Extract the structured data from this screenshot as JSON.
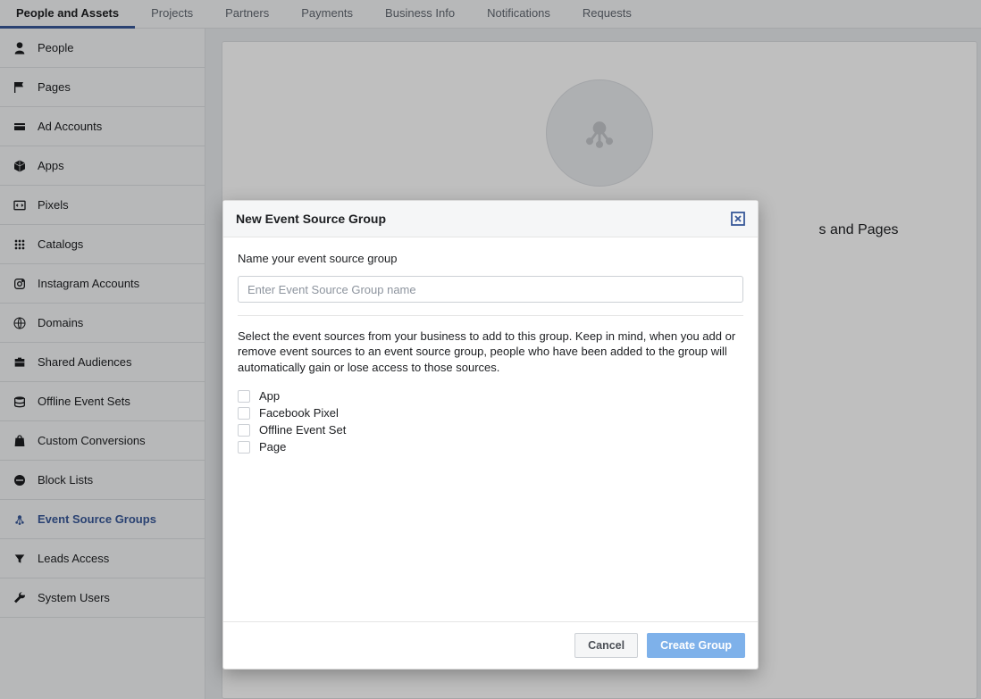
{
  "tabs": [
    {
      "label": "People and Assets",
      "active": true
    },
    {
      "label": "Projects",
      "active": false
    },
    {
      "label": "Partners",
      "active": false
    },
    {
      "label": "Payments",
      "active": false
    },
    {
      "label": "Business Info",
      "active": false
    },
    {
      "label": "Notifications",
      "active": false
    },
    {
      "label": "Requests",
      "active": false
    }
  ],
  "sidebar": [
    {
      "label": "People",
      "icon": "person-icon",
      "active": false
    },
    {
      "label": "Pages",
      "icon": "flag-icon",
      "active": false
    },
    {
      "label": "Ad Accounts",
      "icon": "card-icon",
      "active": false
    },
    {
      "label": "Apps",
      "icon": "cube-icon",
      "active": false
    },
    {
      "label": "Pixels",
      "icon": "code-icon",
      "active": false
    },
    {
      "label": "Catalogs",
      "icon": "grid-icon",
      "active": false
    },
    {
      "label": "Instagram Accounts",
      "icon": "instagram-icon",
      "active": false
    },
    {
      "label": "Domains",
      "icon": "globe-icon",
      "active": false
    },
    {
      "label": "Shared Audiences",
      "icon": "briefcase-icon",
      "active": false
    },
    {
      "label": "Offline Event Sets",
      "icon": "stack-icon",
      "active": false
    },
    {
      "label": "Custom Conversions",
      "icon": "bag-icon",
      "active": false
    },
    {
      "label": "Block Lists",
      "icon": "block-icon",
      "active": false
    },
    {
      "label": "Event Source Groups",
      "icon": "molecule-icon",
      "active": true
    },
    {
      "label": "Leads Access",
      "icon": "funnel-icon",
      "active": false
    },
    {
      "label": "System Users",
      "icon": "wrench-icon",
      "active": false
    }
  ],
  "panel": {
    "visible_text_fragment": "s and Pages"
  },
  "modal": {
    "title": "New Event Source Group",
    "name_label": "Name your event source group",
    "name_placeholder": "Enter Event Source Group name",
    "name_value": "",
    "help_text": "Select the event sources from your business to add to this group. Keep in mind, when you add or remove event sources to an event source group, people who have been added to the group will automatically gain or lose access to those sources.",
    "source_options": [
      {
        "label": "App"
      },
      {
        "label": "Facebook Pixel"
      },
      {
        "label": "Offline Event Set"
      },
      {
        "label": "Page"
      }
    ],
    "cancel_label": "Cancel",
    "submit_label": "Create Group"
  }
}
